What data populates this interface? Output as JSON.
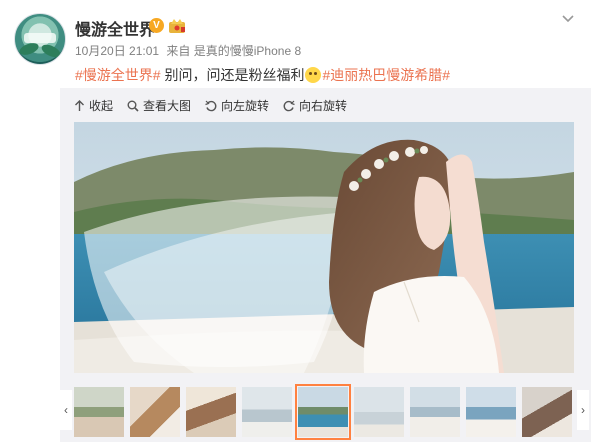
{
  "user": {
    "name": "慢游全世界",
    "verified": "V"
  },
  "post": {
    "date": "10月20日 21:01",
    "source_prefix": "来自",
    "source": "是真的慢慢iPhone 8",
    "tag1": "#慢游全世界#",
    "body": " 别问，问还是粉丝福利",
    "tag2": "#迪丽热巴慢游希腊#"
  },
  "toolbar": {
    "collapse": "收起",
    "view_large": "查看大图",
    "rotate_left": "向左旋转",
    "rotate_right": "向右旋转"
  },
  "gallery": {
    "count": 9,
    "selected_index": 4
  },
  "colors": {
    "tag": "#eb7350",
    "selected_border": "#ff8140",
    "panel": "#f2f2f5"
  },
  "icons": [
    "chevron-down-icon",
    "collapse-icon",
    "zoom-icon",
    "rotate-left-icon",
    "rotate-right-icon",
    "crown-icon",
    "verified-icon"
  ]
}
